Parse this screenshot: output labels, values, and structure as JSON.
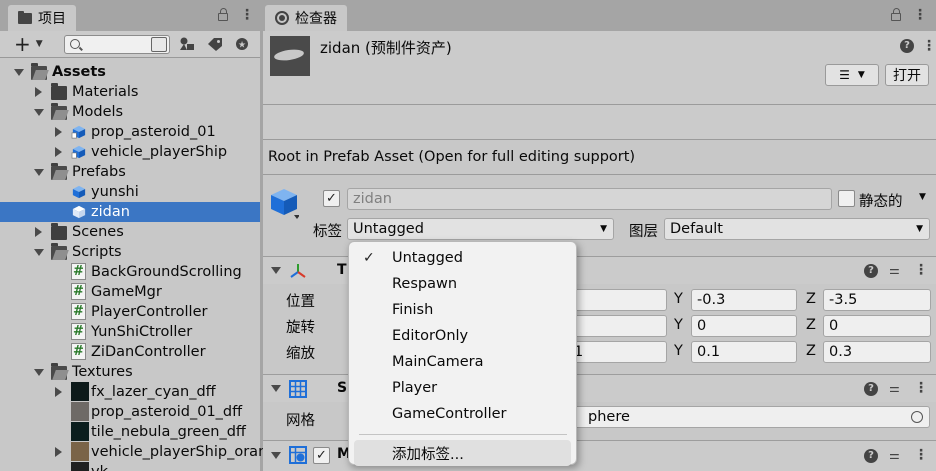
{
  "project_panel": {
    "tab_label": "项目",
    "tree": [
      {
        "label": "Assets",
        "depth": 0,
        "type": "folder",
        "expanded": true,
        "bold": true
      },
      {
        "label": "Materials",
        "depth": 1,
        "type": "folder",
        "expanded": false
      },
      {
        "label": "Models",
        "depth": 1,
        "type": "folder",
        "expanded": true
      },
      {
        "label": "prop_asteroid_01",
        "depth": 2,
        "type": "model",
        "expanded": false
      },
      {
        "label": "vehicle_playerShip",
        "depth": 2,
        "type": "model",
        "expanded": false
      },
      {
        "label": "Prefabs",
        "depth": 1,
        "type": "folder",
        "expanded": true
      },
      {
        "label": "yunshi",
        "depth": 2,
        "type": "prefab"
      },
      {
        "label": "zidan",
        "depth": 2,
        "type": "prefab",
        "selected": true
      },
      {
        "label": "Scenes",
        "depth": 1,
        "type": "folder",
        "expanded": false
      },
      {
        "label": "Scripts",
        "depth": 1,
        "type": "folder",
        "expanded": true
      },
      {
        "label": "BackGroundScrolling",
        "depth": 2,
        "type": "script"
      },
      {
        "label": "GameMgr",
        "depth": 2,
        "type": "script"
      },
      {
        "label": "PlayerController",
        "depth": 2,
        "type": "script"
      },
      {
        "label": "YunShiCtroller",
        "depth": 2,
        "type": "script"
      },
      {
        "label": "ZiDanController",
        "depth": 2,
        "type": "script"
      },
      {
        "label": "Textures",
        "depth": 1,
        "type": "folder",
        "expanded": true
      },
      {
        "label": "fx_lazer_cyan_dff",
        "depth": 2,
        "type": "texture",
        "expanded": false,
        "thumb_color": "#0d1a1a"
      },
      {
        "label": "prop_asteroid_01_dff",
        "depth": 2,
        "type": "texture",
        "thumb_color": "#6e6a66"
      },
      {
        "label": "tile_nebula_green_dff",
        "depth": 2,
        "type": "texture",
        "thumb_color": "#0b1e1e"
      },
      {
        "label": "vehicle_playerShip_oran",
        "depth": 2,
        "type": "texture",
        "expanded": false,
        "thumb_color": "#7a6448"
      },
      {
        "label": "vk",
        "depth": 2,
        "type": "texture",
        "thumb_color": "#202020"
      }
    ]
  },
  "inspector": {
    "tab_label": "检查器",
    "object_title": "zidan (预制件资产)",
    "open_button": "打开",
    "info_text": "Root in Prefab Asset (Open for full editing support)",
    "name_value": "zidan",
    "static_label": "静态的",
    "tag_label": "标签",
    "tag_value": "Untagged",
    "layer_label": "图层",
    "layer_value": "Default",
    "transform": {
      "title_initial": "T",
      "position_label": "位置",
      "rotation_label": "旋转",
      "scale_label": "缩放",
      "y_axis": "Y",
      "z_axis": "Z",
      "position": {
        "y": "-0.3",
        "z": "-3.5"
      },
      "rotation": {
        "y": "0",
        "z": "0"
      },
      "scale": {
        "x_partial": "1",
        "y": "0.1",
        "z": "0.3"
      }
    },
    "mesh_filter": {
      "title_initial": "S",
      "mesh_label": "网格",
      "mesh_value_partial": "phere"
    },
    "mesh_renderer": {
      "title_initial": "M"
    }
  },
  "tag_menu": {
    "items": [
      "Untagged",
      "Respawn",
      "Finish",
      "EditorOnly",
      "MainCamera",
      "Player",
      "GameController"
    ],
    "checked": "Untagged",
    "add_tag": "添加标签..."
  },
  "colors": {
    "selection": "#3b76c4",
    "panel_bg": "#c8c8c8",
    "cube_blue": "#1f6fd8"
  }
}
